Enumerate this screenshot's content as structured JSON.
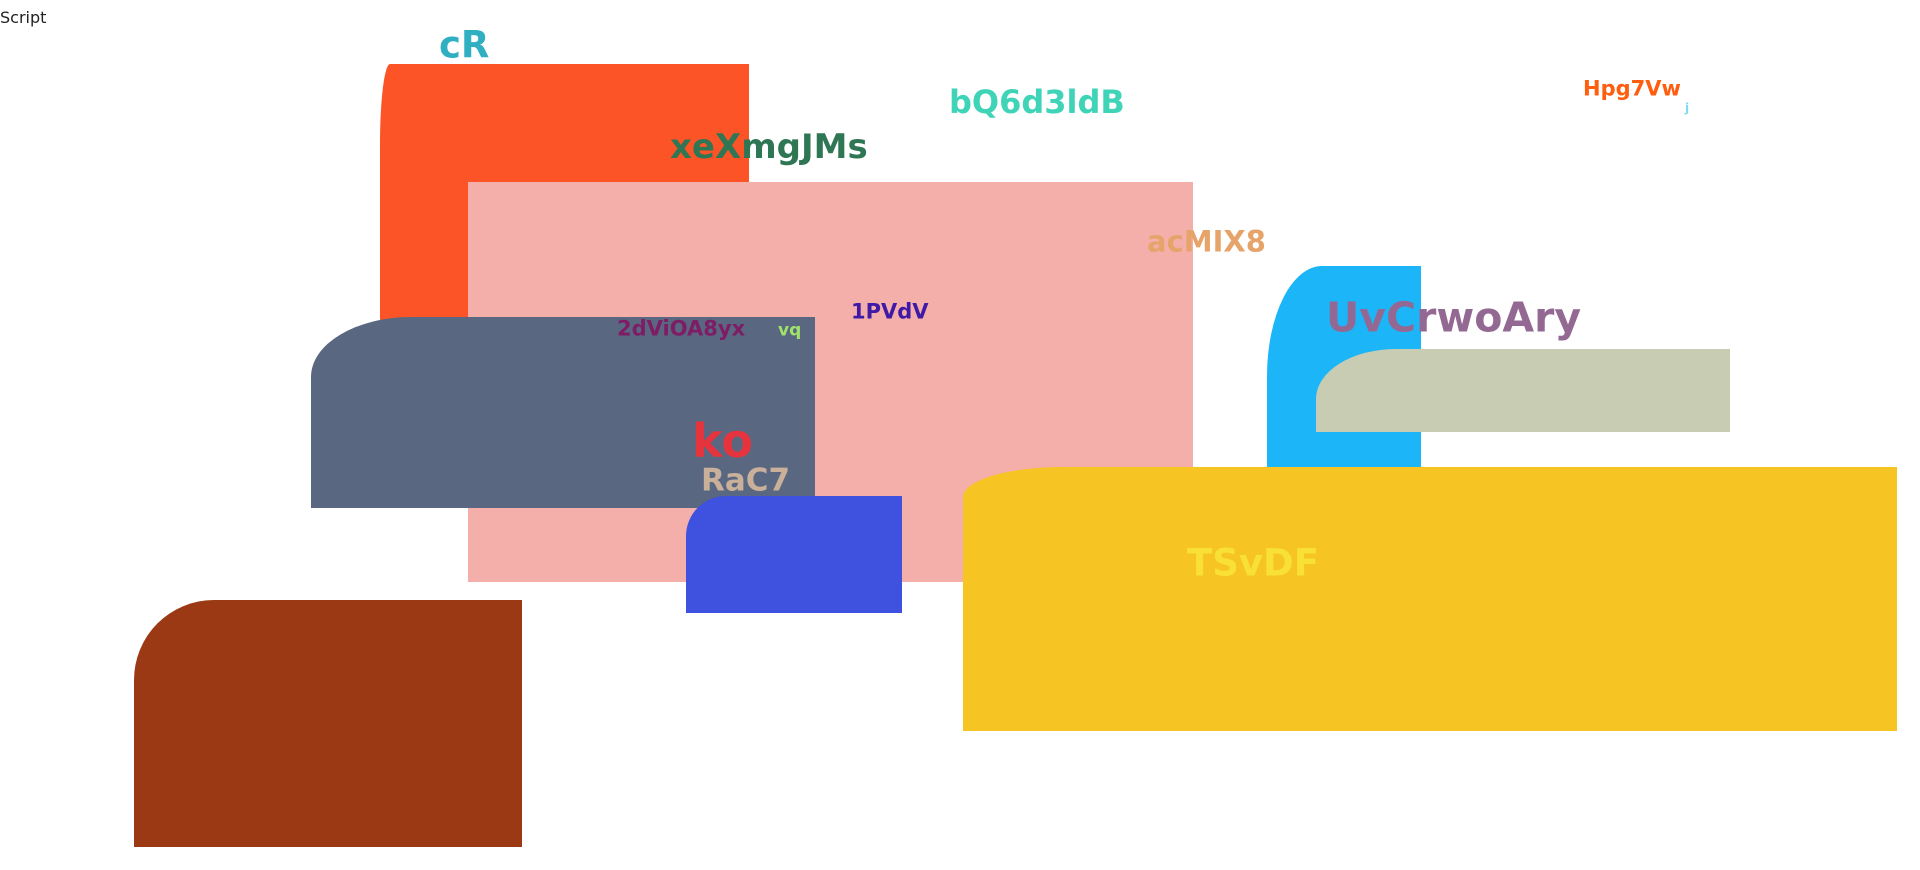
{
  "corner_label": "Script",
  "blocks": [
    {
      "name": "orange-red-block",
      "color": "#FC5427"
    },
    {
      "name": "pink-block",
      "color": "#F5AFAB"
    },
    {
      "name": "slate-block",
      "color": "#5A6780"
    },
    {
      "name": "royal-blue-block",
      "color": "#3F51DF"
    },
    {
      "name": "rust-block",
      "color": "#9B3914"
    },
    {
      "name": "sky-blue-block",
      "color": "#1CB5F8"
    },
    {
      "name": "sage-block",
      "color": "#C8CCB2"
    },
    {
      "name": "yellow-block",
      "color": "#F6C423"
    }
  ],
  "labels": [
    {
      "name": "label-cR",
      "text": "cR",
      "color": "#2FAFC1"
    },
    {
      "name": "label-bQ6d3ldB",
      "text": "bQ6d3ldB",
      "color": "#3FD3B8"
    },
    {
      "name": "label-Hpg7Vw",
      "text": "Hpg7Vw",
      "color": "#FF5E0E"
    },
    {
      "name": "label-j",
      "text": "j",
      "color": "#7FDCF0"
    },
    {
      "name": "label-xeXmgJMs",
      "text": "xeXmgJMs",
      "color": "#2E7654"
    },
    {
      "name": "label-acMIX8",
      "text": "acMIX8",
      "color": "#E7A46A"
    },
    {
      "name": "label-1PVdV",
      "text": "1PVdV",
      "color": "#3F1AA6"
    },
    {
      "name": "label-2dViOA8yx",
      "text": "2dViOA8yx",
      "color": "#7E1D65"
    },
    {
      "name": "label-vq",
      "text": "vq",
      "color": "#9EE36A"
    },
    {
      "name": "label-UvCrwoAry",
      "text": "UvCrwoAry",
      "color": "#936993"
    },
    {
      "name": "label-ko",
      "text": "ko",
      "color": "#E5343D"
    },
    {
      "name": "label-RaC7",
      "text": "RaC7",
      "color": "#C9B09B"
    },
    {
      "name": "label-TSvDF",
      "text": "TSvDF",
      "color": "#F8E034"
    }
  ]
}
